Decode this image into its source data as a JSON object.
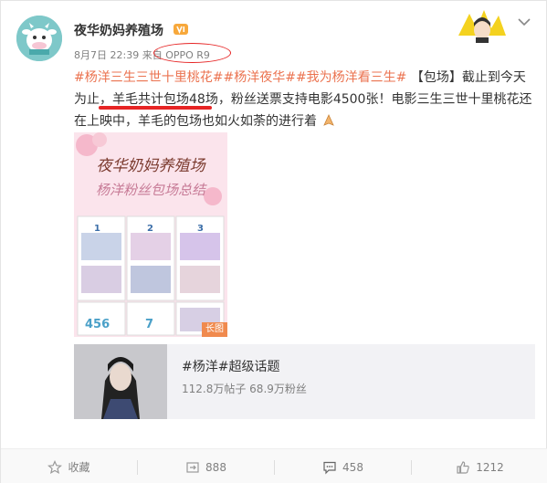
{
  "post": {
    "username": "夜华奶妈养殖场",
    "timestamp": "8月7日 22:39",
    "source_prefix": "来自",
    "source_device": "OPPO R9",
    "tag1": "#杨洋三生三世十里桃花#",
    "tag2": "#杨洋夜华#",
    "tag3": "#我为杨洋看三生#",
    "text_a": "【包场】截止到今天为止，",
    "text_highlight": "羊毛共计包场48场",
    "text_b": "，粉丝送票支持电影4500张！电影三生三世十里桃花还在上映中，羊毛的包场也如火如荼的进行着",
    "image_title_line1": "夜华奶妈养殖场",
    "image_title_line2": "杨洋粉丝包场总结",
    "image_numbers": [
      "1",
      "2",
      "3",
      "456",
      "7"
    ],
    "long_image_label": "长图"
  },
  "topic": {
    "title": "#杨洋#超级话题",
    "stats": "112.8万帖子 68.9万粉丝"
  },
  "actions": {
    "favorite": "收藏",
    "repost": "888",
    "comment": "458",
    "like": "1212"
  },
  "colors": {
    "accent": "#eb7350",
    "annotation": "#e62424",
    "muted": "#808080"
  },
  "icons": [
    "avatar-cow-logo",
    "vip-badge-icon",
    "chevron-down-icon",
    "pray-hands-emoji",
    "star-icon",
    "repost-icon",
    "comment-icon",
    "like-icon"
  ]
}
